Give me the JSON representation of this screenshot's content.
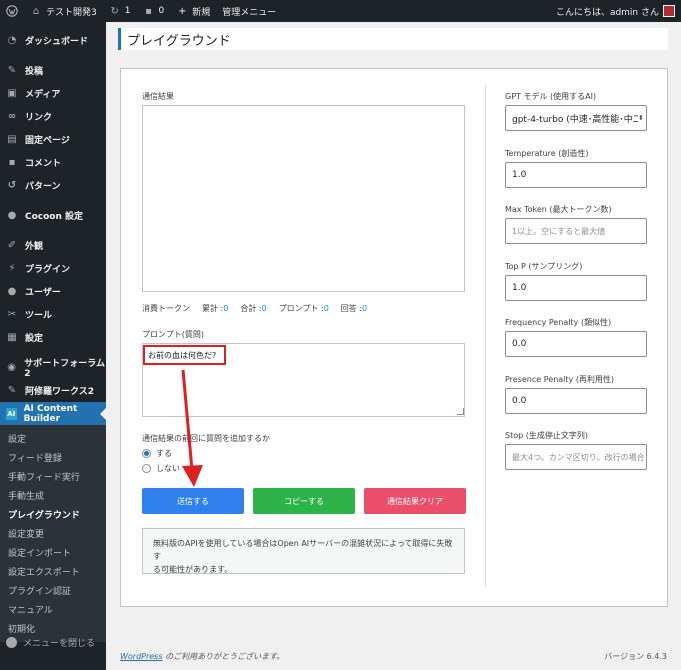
{
  "adminbar": {
    "site_name": "テスト開発3",
    "updates_count": "1",
    "comments_count": "0",
    "new_label": "新規",
    "admin_menu_label": "管理メニュー",
    "greeting": "こんにちは、admin さん"
  },
  "sidebar": {
    "items": [
      {
        "label": "ダッシュボード",
        "icon": "dashboard-icon"
      },
      {
        "label": "投稿",
        "icon": "pin-icon"
      },
      {
        "label": "メディア",
        "icon": "media-icon"
      },
      {
        "label": "リンク",
        "icon": "link-icon"
      },
      {
        "label": "固定ページ",
        "icon": "page-icon"
      },
      {
        "label": "コメント",
        "icon": "comment-icon"
      },
      {
        "label": "パターン",
        "icon": "pattern-icon"
      },
      {
        "label": "Cocoon 設定",
        "icon": "cocoon-icon"
      },
      {
        "label": "外観",
        "icon": "brush-icon"
      },
      {
        "label": "プラグイン",
        "icon": "plugin-icon"
      },
      {
        "label": "ユーザー",
        "icon": "user-icon"
      },
      {
        "label": "ツール",
        "icon": "tool-icon"
      },
      {
        "label": "設定",
        "icon": "settings-icon"
      },
      {
        "label": "サポートフォーラム2",
        "icon": "support-icon"
      },
      {
        "label": "阿修羅ワークス2",
        "icon": "wrench-icon"
      },
      {
        "label": "AI Content Builder",
        "icon": "ai-icon"
      }
    ],
    "submenu": [
      "設定",
      "フィード登録",
      "手動フィード実行",
      "手動生成",
      "プレイグラウンド",
      "設定変更",
      "設定インポート",
      "設定エクスポート",
      "プラグイン認証",
      "マニュアル",
      "初期化"
    ],
    "collapse_label": "メニューを閉じる"
  },
  "page": {
    "title": "プレイグラウンド",
    "result_label": "通信結果",
    "stats": {
      "consumed_label": "消費トークン",
      "total_label": "累計 :",
      "total_value": "0",
      "sum_label": "合計 :",
      "sum_value": "0",
      "prompt_label": "プロンプト :",
      "prompt_value": "0",
      "answer_label": "回答 :",
      "answer_value": "0"
    },
    "prompt_label": "プロンプト(質問)",
    "prompt_value": "お前の血は何色だ?",
    "append_label": "通信結果の前回に質問を追加するか",
    "radio_yes": "する",
    "radio_no": "しない",
    "send_button": "送信する",
    "copy_button": "コピーする",
    "clear_button": "通信結果クリア",
    "notice_line1": "無料版のAPIを使用している場合はOpen AIサーバーの混雑状況によって取得に失敗す",
    "notice_line2": "る可能性があります。"
  },
  "settings": {
    "model_label": "GPT モデル (使用するAI)",
    "model_value": "gpt-4-turbo (中速･高性能･中二",
    "temperature_label": "Temperature (創造性)",
    "temperature_value": "1.0",
    "max_token_label": "Max Token (最大トークン数)",
    "max_token_placeholder": "1以上。空にすると最大値",
    "top_p_label": "Top P (サンプリング)",
    "top_p_value": "1.0",
    "frequency_label": "Frequency Penalty (類似性)",
    "frequency_value": "0.0",
    "presence_label": "Presence Penalty (再利用性)",
    "presence_value": "0.0",
    "stop_label": "Stop (生成停止文字列)",
    "stop_placeholder": "最大4つ。カンマ区切り。改行の場合"
  },
  "footer": {
    "wordpress_link": "WordPress",
    "thanks": " のご利用ありがとうございます。",
    "version": "バージョン 6.4.3"
  },
  "colors": {
    "accent": "#2271b1",
    "send_button": "#2f80ed",
    "copy_button": "#2eb34b",
    "clear_button": "#e94f6b",
    "annotation": "#e02020"
  }
}
